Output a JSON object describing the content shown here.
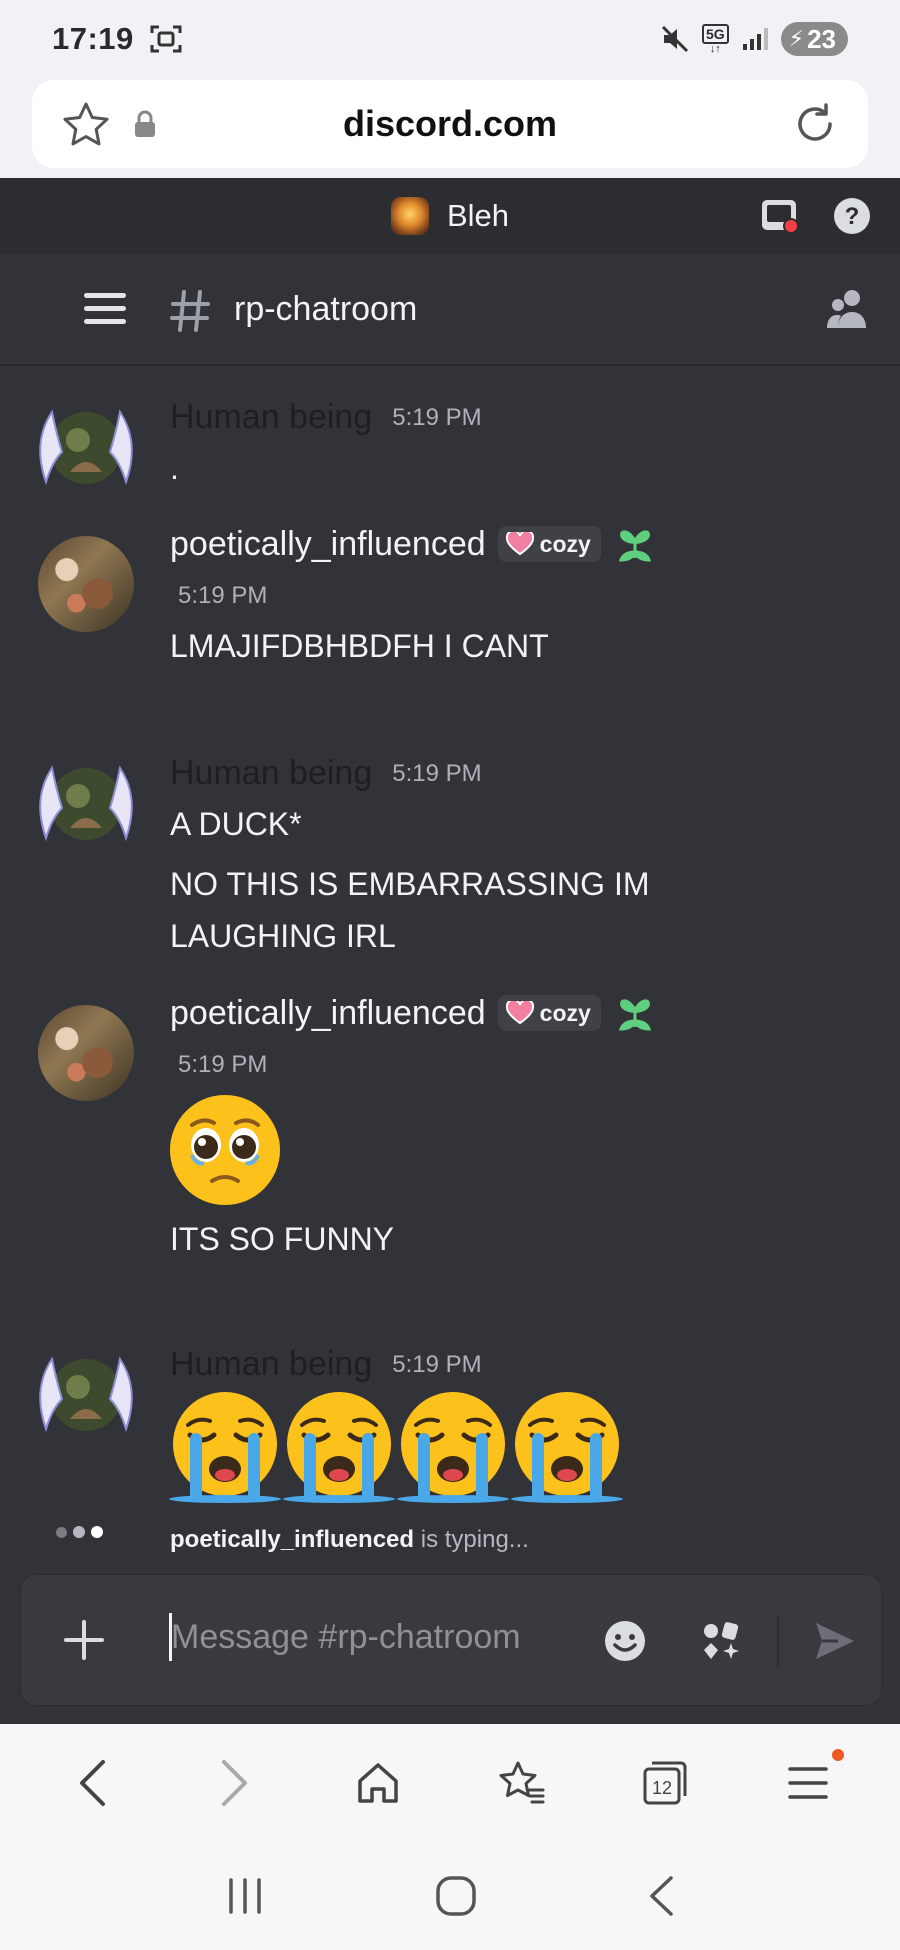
{
  "status_bar": {
    "time": "17:19",
    "network": "5G",
    "battery": "23"
  },
  "browser": {
    "url": "discord.com",
    "tab_count": "12"
  },
  "server": {
    "name": "Bleh"
  },
  "channel": {
    "name": "rp-chatroom"
  },
  "messages": [
    {
      "author": "Human being",
      "timestamp": "5:19 PM",
      "lines": [
        "."
      ]
    },
    {
      "author": "poetically_influenced",
      "tag": "cozy",
      "timestamp": "5:19 PM",
      "lines": [
        "LMAJIFDBHBDFH I CANT"
      ]
    },
    {
      "author": "Human being",
      "timestamp": "5:19 PM",
      "lines": [
        "A DUCK*",
        "NO THIS IS EMBARRASSING IM LAUGHING IRL"
      ]
    },
    {
      "author": "poetically_influenced",
      "tag": "cozy",
      "timestamp": "5:19 PM",
      "emoji": [
        "pleading-face-emoji"
      ],
      "lines": [
        "ITS SO FUNNY"
      ]
    },
    {
      "author": "Human being",
      "timestamp": "5:19 PM",
      "emoji": [
        "loudly-crying-face-emoji",
        "loudly-crying-face-emoji",
        "loudly-crying-face-emoji",
        "loudly-crying-face-emoji"
      ]
    }
  ],
  "typing": {
    "user": "poetically_influenced",
    "suffix": " is typing..."
  },
  "composer": {
    "placeholder": "Message #rp-chatroom"
  },
  "colors": {
    "discord_bg": "#313338",
    "server_bar": "#2b2d31",
    "composer_bg": "#383a40",
    "tag_bg": "#3f4147",
    "heart": "#f27fa0",
    "decoration_green": "#5fcf7f",
    "notification_dot": "#f05a22"
  }
}
